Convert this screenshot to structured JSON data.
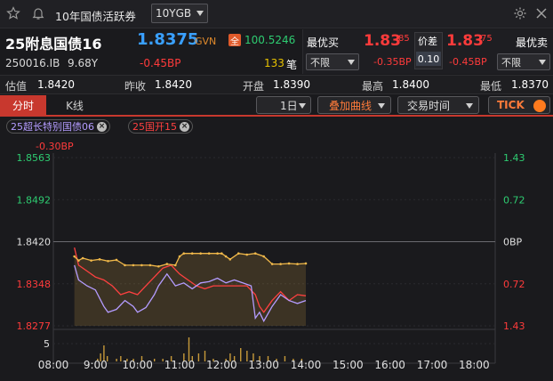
{
  "window": {
    "title": "10年国债活跃券",
    "selector": "10YGB"
  },
  "quote": {
    "name": "25附息国债16",
    "price": "1.8375",
    "source": "GVN",
    "net_badge": "全",
    "net_price": "100.5246",
    "code": "250016.IB",
    "tenor": "9.68Y",
    "change": "-0.45BP",
    "volume": "133",
    "volume_unit": "笔"
  },
  "best_bid": {
    "label": "最优买",
    "price_main": "1.83",
    "price_sub": "85",
    "filter": "不限",
    "change": "-0.35BP"
  },
  "spread": {
    "label": "价差",
    "value": "0.10"
  },
  "best_ask": {
    "label": "最优卖",
    "price_main": "1.83",
    "price_sub": "75",
    "filter": "不限",
    "change": "-0.45BP"
  },
  "stats": [
    {
      "label": "估值",
      "value": "1.8420"
    },
    {
      "label": "昨收",
      "value": "1.8420"
    },
    {
      "label": "开盘",
      "value": "1.8390"
    },
    {
      "label": "最高",
      "value": "1.8400"
    },
    {
      "label": "最低",
      "value": "1.8370"
    }
  ],
  "toolbar": {
    "tabs": [
      "分时",
      "K线"
    ],
    "period": "1日",
    "overlay": "叠加曲线",
    "trade_time": "交易时间",
    "tick": "TICK"
  },
  "overlays": [
    {
      "name": "25超长特别国债06",
      "color": "#b49cff"
    },
    {
      "name": "25国开15",
      "color": "#ff4040"
    }
  ],
  "colors": {
    "main_line": "#f0b84a",
    "compare1": "#b49cff",
    "compare2": "#ff4040",
    "up": "#ff3b3b",
    "down": "#2ecc71",
    "accent": "#3aa0ff"
  },
  "chart_data": {
    "type": "line",
    "spread_label": "-0.30BP",
    "y_left_ticks": [
      "1.8563",
      "1.8492",
      "1.8420",
      "1.8348",
      "1.8277"
    ],
    "y_right_ticks": [
      "1.43",
      "0.72",
      "0BP",
      "0.72",
      "1.43"
    ],
    "ylim": [
      1.8277,
      1.8563
    ],
    "x_ticks": [
      "08:00",
      "9:00",
      "10:00",
      "11:00",
      "12:00",
      "13:00",
      "14:00",
      "15:00",
      "16:00",
      "17:00",
      "18:00"
    ],
    "x_range_hours": [
      8,
      18.5
    ],
    "volume_tick": "5",
    "series": [
      {
        "name": "25附息国债16",
        "color": "#f0b84a",
        "x": [
          8.5,
          8.6,
          8.7,
          8.9,
          9.1,
          9.3,
          9.5,
          9.7,
          9.9,
          10.1,
          10.3,
          10.5,
          10.7,
          10.9,
          11.0,
          11.1,
          11.3,
          11.5,
          11.7,
          11.9,
          12.0,
          12.1,
          12.2,
          12.4,
          12.6,
          12.8,
          13.0,
          13.2,
          13.4,
          13.6,
          13.8,
          14.0
        ],
        "y": [
          1.8395,
          1.8388,
          1.8392,
          1.8388,
          1.839,
          1.8387,
          1.8389,
          1.838,
          1.838,
          1.838,
          1.838,
          1.8378,
          1.8382,
          1.838,
          1.8395,
          1.84,
          1.84,
          1.84,
          1.84,
          1.84,
          1.84,
          1.8395,
          1.839,
          1.84,
          1.8398,
          1.84,
          1.8395,
          1.8382,
          1.8382,
          1.8383,
          1.8382,
          1.8383
        ]
      },
      {
        "name": "25超长特别国债06",
        "color": "#b49cff",
        "x": [
          8.5,
          8.6,
          8.8,
          9.0,
          9.2,
          9.3,
          9.5,
          9.7,
          9.9,
          10.0,
          10.2,
          10.4,
          10.5,
          10.7,
          10.9,
          11.1,
          11.3,
          11.5,
          11.7,
          11.9,
          12.1,
          12.3,
          12.5,
          12.7,
          12.8,
          12.9,
          13.0,
          13.2,
          13.4,
          13.6,
          13.8,
          14.0
        ],
        "y": [
          1.838,
          1.8355,
          1.8345,
          1.8338,
          1.831,
          1.83,
          1.8305,
          1.832,
          1.831,
          1.83,
          1.8308,
          1.833,
          1.8345,
          1.8365,
          1.8345,
          1.835,
          1.834,
          1.835,
          1.8352,
          1.8358,
          1.835,
          1.8355,
          1.835,
          1.8345,
          1.829,
          1.83,
          1.8285,
          1.831,
          1.833,
          1.832,
          1.8315,
          1.832
        ]
      },
      {
        "name": "25国开15",
        "color": "#ff4040",
        "x": [
          8.5,
          8.6,
          8.8,
          9.0,
          9.2,
          9.4,
          9.6,
          9.8,
          10.0,
          10.2,
          10.4,
          10.6,
          10.8,
          11.0,
          11.2,
          11.4,
          11.6,
          11.8,
          12.0,
          12.2,
          12.4,
          12.6,
          12.8,
          12.9,
          13.0,
          13.2,
          13.4,
          13.6,
          13.8,
          14.0
        ],
        "y": [
          1.841,
          1.838,
          1.837,
          1.836,
          1.8355,
          1.8345,
          1.833,
          1.8335,
          1.833,
          1.8345,
          1.836,
          1.8375,
          1.838,
          1.8365,
          1.8355,
          1.8345,
          1.834,
          1.8345,
          1.8345,
          1.8345,
          1.8345,
          1.8345,
          1.833,
          1.831,
          1.83,
          1.832,
          1.8335,
          1.832,
          1.833,
          1.8328
        ]
      }
    ],
    "volume": {
      "x": [
        9.05,
        9.12,
        9.2,
        9.28,
        9.5,
        9.6,
        9.75,
        9.9,
        10.1,
        10.4,
        10.6,
        10.8,
        11.1,
        11.22,
        11.3,
        11.45,
        11.6,
        11.8,
        12.1,
        12.2,
        12.3,
        12.45,
        12.6,
        12.75,
        12.9,
        13.1,
        13.3,
        13.5,
        13.7,
        13.9
      ],
      "v": [
        1,
        3,
        6,
        2,
        1,
        2,
        1,
        1,
        2,
        1,
        1,
        2,
        3,
        9,
        2,
        3,
        4,
        1,
        1,
        3,
        2,
        5,
        4,
        3,
        2,
        2,
        1,
        2,
        1,
        1
      ]
    }
  }
}
